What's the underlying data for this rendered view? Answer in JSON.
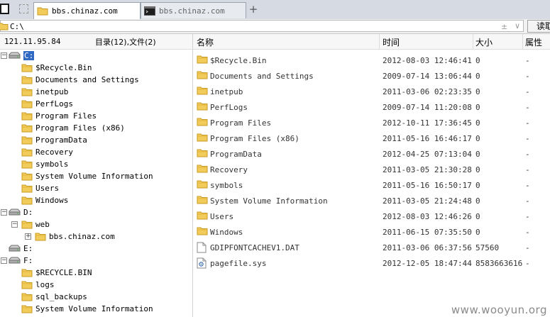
{
  "tabs": [
    {
      "label": "bbs.chinaz.com",
      "active": true
    },
    {
      "label": "bbs.chinaz.com",
      "active": false
    }
  ],
  "address": {
    "path": "C:\\",
    "read_button": "读取"
  },
  "left_header": {
    "ip": "121.11.95.84",
    "counts": "目录(12),文件(2)"
  },
  "tree": [
    {
      "label": "C:",
      "type": "drive",
      "level": 0,
      "expanded": true,
      "selected": true
    },
    {
      "label": "$Recycle.Bin",
      "type": "folder",
      "level": 1
    },
    {
      "label": "Documents and Settings",
      "type": "folder",
      "level": 1
    },
    {
      "label": "inetpub",
      "type": "folder",
      "level": 1
    },
    {
      "label": "PerfLogs",
      "type": "folder",
      "level": 1
    },
    {
      "label": "Program Files",
      "type": "folder",
      "level": 1
    },
    {
      "label": "Program Files (x86)",
      "type": "folder",
      "level": 1
    },
    {
      "label": "ProgramData",
      "type": "folder",
      "level": 1
    },
    {
      "label": "Recovery",
      "type": "folder",
      "level": 1
    },
    {
      "label": "symbols",
      "type": "folder",
      "level": 1
    },
    {
      "label": "System Volume Information",
      "type": "folder",
      "level": 1
    },
    {
      "label": "Users",
      "type": "folder",
      "level": 1
    },
    {
      "label": "Windows",
      "type": "folder",
      "level": 1
    },
    {
      "label": "D:",
      "type": "drive",
      "level": 0,
      "expanded": true
    },
    {
      "label": "web",
      "type": "folder",
      "level": 1,
      "expanded": true
    },
    {
      "label": "bbs.chinaz.com",
      "type": "folder",
      "level": 2,
      "collapsed": true
    },
    {
      "label": "E:",
      "type": "drive",
      "level": 0
    },
    {
      "label": "F:",
      "type": "drive",
      "level": 0,
      "expanded": true
    },
    {
      "label": "$RECYCLE.BIN",
      "type": "folder",
      "level": 1
    },
    {
      "label": "logs",
      "type": "folder",
      "level": 1
    },
    {
      "label": "sql_backups",
      "type": "folder",
      "level": 1
    },
    {
      "label": "System Volume Information",
      "type": "folder",
      "level": 1
    }
  ],
  "columns": {
    "name": "名称",
    "time": "时间",
    "size": "大小",
    "attr": "属性"
  },
  "files": [
    {
      "name": "$Recycle.Bin",
      "time": "2012-08-03 12:46:41",
      "size": "0",
      "attr": "-",
      "icon": "folder-icon"
    },
    {
      "name": "Documents and Settings",
      "time": "2009-07-14 13:06:44",
      "size": "0",
      "attr": "-",
      "icon": "folder-icon"
    },
    {
      "name": "inetpub",
      "time": "2011-03-06 02:23:35",
      "size": "0",
      "attr": "-",
      "icon": "folder-icon"
    },
    {
      "name": "PerfLogs",
      "time": "2009-07-14 11:20:08",
      "size": "0",
      "attr": "-",
      "icon": "folder-icon"
    },
    {
      "name": "Program Files",
      "time": "2012-10-11 17:36:45",
      "size": "0",
      "attr": "-",
      "icon": "folder-icon"
    },
    {
      "name": "Program Files (x86)",
      "time": "2011-05-16 16:46:17",
      "size": "0",
      "attr": "-",
      "icon": "folder-icon"
    },
    {
      "name": "ProgramData",
      "time": "2012-04-25 07:13:04",
      "size": "0",
      "attr": "-",
      "icon": "folder-icon"
    },
    {
      "name": "Recovery",
      "time": "2011-03-05 21:30:28",
      "size": "0",
      "attr": "-",
      "icon": "folder-icon"
    },
    {
      "name": "symbols",
      "time": "2011-05-16 16:50:17",
      "size": "0",
      "attr": "-",
      "icon": "folder-icon"
    },
    {
      "name": "System Volume Information",
      "time": "2011-03-05 21:24:48",
      "size": "0",
      "attr": "-",
      "icon": "folder-icon"
    },
    {
      "name": "Users",
      "time": "2012-08-03 12:46:26",
      "size": "0",
      "attr": "-",
      "icon": "folder-icon"
    },
    {
      "name": "Windows",
      "time": "2011-06-15 07:35:50",
      "size": "0",
      "attr": "-",
      "icon": "folder-icon"
    },
    {
      "name": "GDIPFONTCACHEV1.DAT",
      "time": "2011-03-06 06:37:56",
      "size": "57560",
      "attr": "-",
      "icon": "file-icon"
    },
    {
      "name": "pagefile.sys",
      "time": "2012-12-05 18:47:44",
      "size": "8583663616",
      "attr": "-",
      "icon": "system-file-icon"
    }
  ],
  "watermark": "www.wooyun.org",
  "colors": {
    "folder": "#f2cc5a",
    "folder_stroke": "#c99a22",
    "selection": "#316ac5"
  }
}
